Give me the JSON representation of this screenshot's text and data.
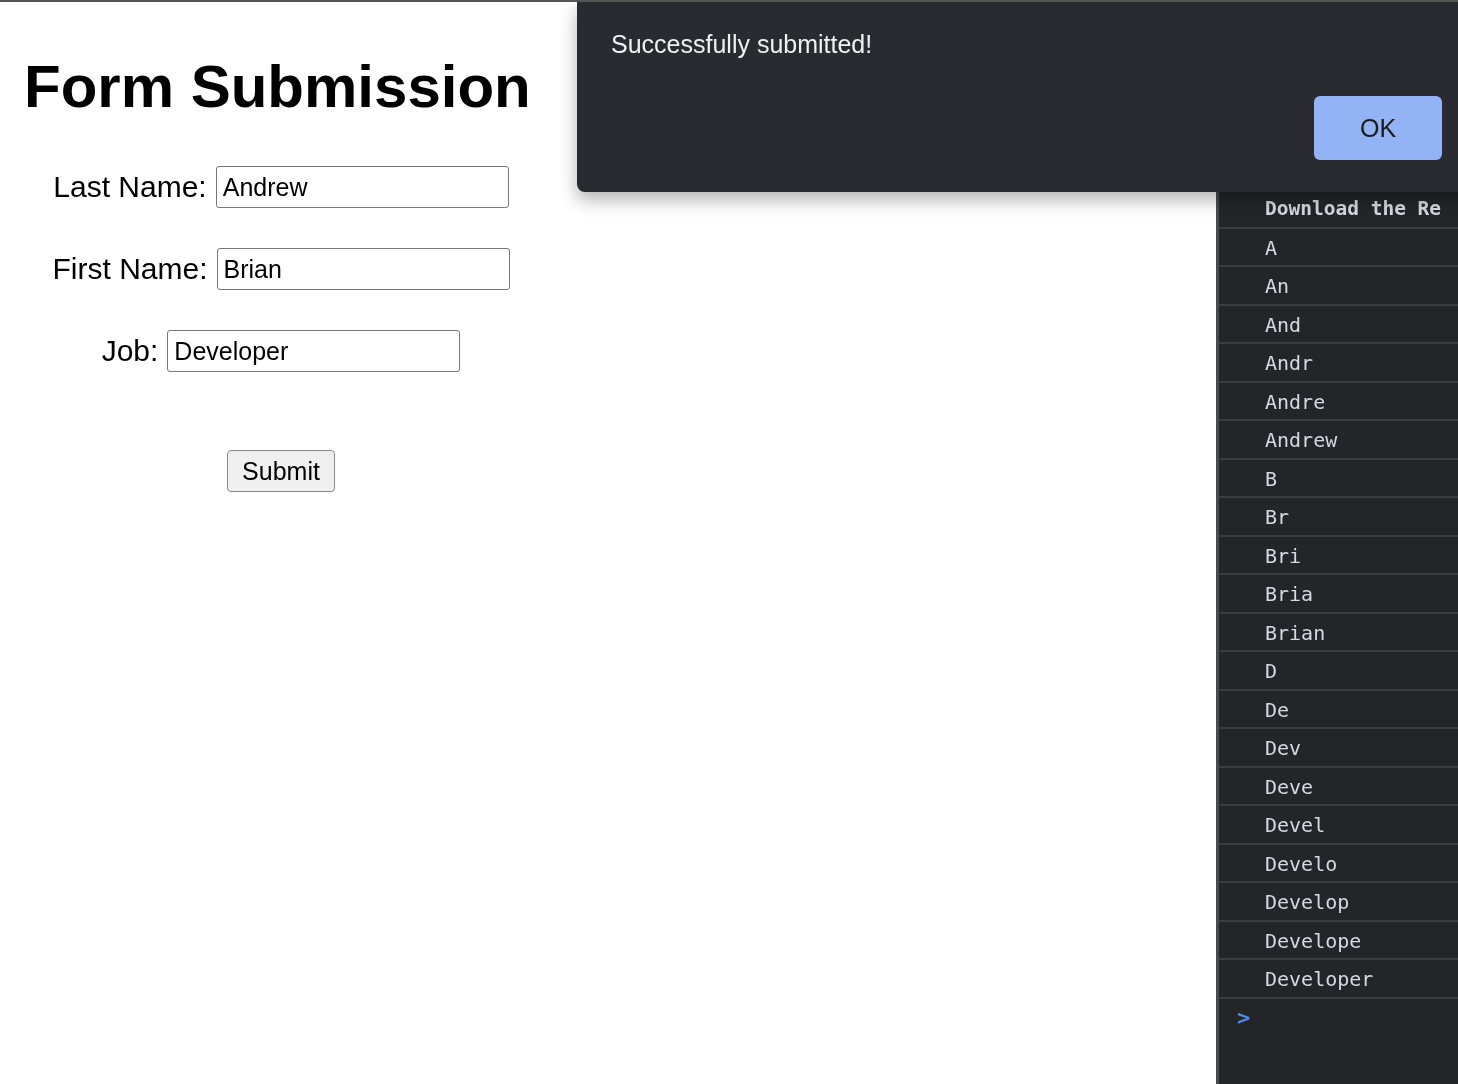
{
  "page": {
    "title": "Form Submission",
    "fields": [
      {
        "label": "Last Name:",
        "value": "Andrew"
      },
      {
        "label": "First Name:",
        "value": "Brian"
      },
      {
        "label": "Job:",
        "value": "Developer"
      }
    ],
    "submit_button": "Submit"
  },
  "console": {
    "heading": "Download the Re",
    "lines": [
      "A",
      "An",
      "And",
      "Andr",
      "Andre",
      "Andrew",
      "B",
      "Br",
      "Bri",
      "Bria",
      "Brian",
      "D",
      "De",
      "Dev",
      "Deve",
      "Devel",
      "Develo",
      "Develop",
      "Develope",
      "Developer"
    ],
    "prompt": ">"
  },
  "dialog": {
    "message": "Successfully submitted!",
    "button": "OK"
  }
}
